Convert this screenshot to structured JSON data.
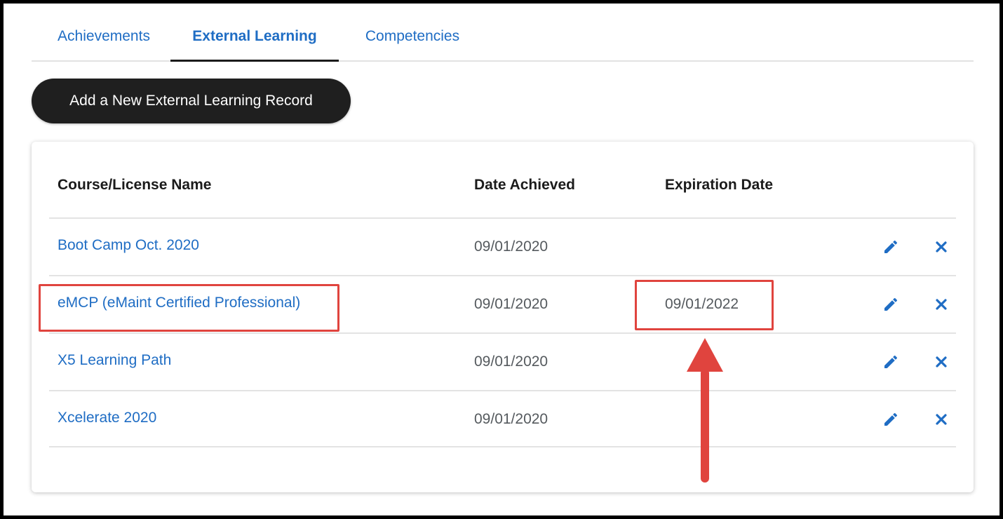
{
  "colors": {
    "link": "#1f6dc4",
    "annotation": "#e0443e",
    "button_bg": "#1f1f1f"
  },
  "tabs": [
    {
      "label": "Achievements",
      "active": false
    },
    {
      "label": "External Learning",
      "active": true
    },
    {
      "label": "Competencies",
      "active": false
    }
  ],
  "add_button_label": "Add a New External Learning Record",
  "table": {
    "columns": [
      "Course/License Name",
      "Date Achieved",
      "Expiration Date"
    ],
    "rows": [
      {
        "name": "Boot Camp Oct. 2020",
        "date_achieved": "09/01/2020",
        "expiration_date": ""
      },
      {
        "name": "eMCP (eMaint Certified Professional)",
        "date_achieved": "09/01/2020",
        "expiration_date": "09/01/2022"
      },
      {
        "name": "X5 Learning Path",
        "date_achieved": "09/01/2020",
        "expiration_date": ""
      },
      {
        "name": "Xcelerate 2020",
        "date_achieved": "09/01/2020",
        "expiration_date": ""
      }
    ],
    "row_actions": {
      "edit_icon": "pencil-icon",
      "delete_icon": "close-icon"
    }
  }
}
